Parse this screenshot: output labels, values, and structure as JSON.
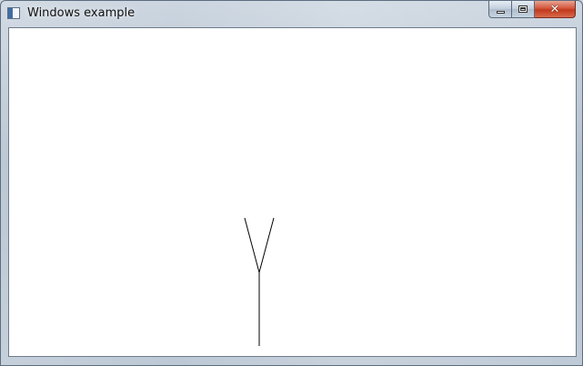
{
  "window": {
    "title": "Windows example",
    "icon": "app-window-icon"
  },
  "caption_buttons": {
    "minimize_icon": "minimize-icon",
    "maximize_icon": "maximize-icon",
    "close_icon": "close-icon",
    "close_glyph": "✕"
  },
  "canvas": {
    "background": "#ffffff",
    "stroke_color": "#000000"
  }
}
